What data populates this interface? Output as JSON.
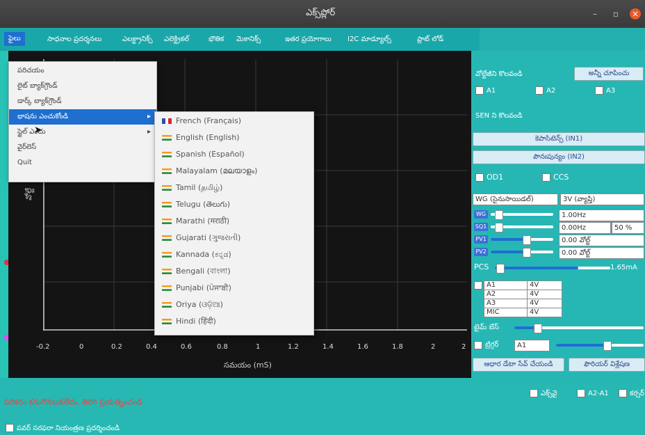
{
  "window": {
    "title": "ఎక్స్‌ప్లోర్"
  },
  "menubar": {
    "items": [
      "ఫైలు",
      "సాధనాల ప్రదర్శనలు",
      "ఎలక్ట్రానిక్స్",
      "ఎలెక్ట్రికల్",
      "భౌతిక",
      "మెకానిక్స్",
      "ఇతర ప్రయోగాలు",
      "I2C మాడ్యూల్స్",
      "ప్లాట్ లోడ్"
    ]
  },
  "file_menu": {
    "items": [
      "పరిచయం",
      "లైట్ బ్యాక్‌గ్రౌండ్",
      "డార్క్ బ్యాక్‌గ్రౌండ్",
      "భాషను ఎంచుకోండి",
      "స్టైల్ ఎంచు",
      "వైర్‌లెస్",
      "Quit"
    ]
  },
  "language_menu": {
    "items": [
      "French (Français)",
      "English (English)",
      "Spanish (Español)",
      "Malayalam (മലയാളം)",
      "Tamil (தமிழ்)",
      "Telugu (తెలుగు)",
      "Marathi (मराठी)",
      "Gujarati (ગુજરાતી)",
      "Kannada (ಕನ್ನಡ)",
      "Bengali (বাংলা)",
      "Punjabi (ਪੰਜਾਬੀ)",
      "Oriya (ଓଡ଼ିଆ)",
      "Hindi (हिंदी)"
    ]
  },
  "plot": {
    "xlabel": "సమయం (mS)",
    "ylabel": "వోల్టే",
    "xticks": [
      "-0.2",
      "0",
      "0.2",
      "0.4",
      "0.6",
      "0.8",
      "1",
      "1.2",
      "1.4",
      "1.6",
      "1.8",
      "2",
      "2"
    ]
  },
  "right_panel": {
    "header": "వోల్టేజీని కొలవండి",
    "header_button": "అన్నీ చూపించు",
    "a1": "A1",
    "a2": "A2",
    "a3": "A3",
    "sen": "SEN ని కొలవండి",
    "btn_in1": "కెపాసిటెన్స్ (IN1)",
    "btn_in2": "పౌనఃపున్యం (IN2)",
    "od1": "OD1",
    "ccs": "CCS",
    "wg_select": "WG (సైనుసాయిడల్)",
    "wg_amp": "3V (వ్యాప్తి)",
    "wg_freq": "1.00Hz",
    "sq1_freq": "0.00Hz",
    "sq1_duty": "50 %",
    "pv1": "0.00 వోల్ట్",
    "pv2": "0.00 వోల్ట్",
    "pcs_label": "PCS",
    "pcs_value": "1.65mA",
    "chan_labels": [
      "WG",
      "SQ1",
      "PV1",
      "PV2"
    ],
    "channels": [
      {
        "name": "A1",
        "range": "4V"
      },
      {
        "name": "A2",
        "range": "4V"
      },
      {
        "name": "A3",
        "range": "4V"
      },
      {
        "name": "MIC",
        "range": "4V"
      }
    ],
    "time_label": "టైమ్ బేస్",
    "trigger_label": "ట్రిగ్గర్",
    "trigger_chan": "A1",
    "btn_save": "ఆధార డేటా సేవ్ చేయండి",
    "btn_fourier": "ఫౌరియర్ విశ్లేషణ",
    "check_xy": "ఎక్స్‌వై",
    "check_a2a1": "A2-A1",
    "check_cursor": "కర్సర్"
  },
  "bottom": {
    "status": "పరికరం కనుగొనబడలేదు. తిరిగి ప్రయత్నించండి",
    "checkbox_label": "పవర్ సరఫరా నియంత్రణ ప్రదర్శించండి"
  },
  "colors": {
    "accent": "#1e6fd0",
    "teal": "#1aa7a9",
    "status_red": "#ff3a3a"
  }
}
